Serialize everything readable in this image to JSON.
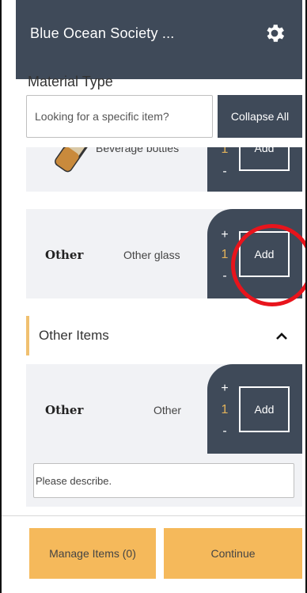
{
  "header": {
    "title": "Blue Ocean Society ...",
    "settings_icon": "gear-icon"
  },
  "section": {
    "title": "Material Type"
  },
  "search": {
    "placeholder": "Looking for a specific item?"
  },
  "collapse_all": {
    "label": "Collapse All"
  },
  "items": [
    {
      "icon": "beverage-bottle-icon",
      "name": "Beverage bottles",
      "plus": "+",
      "quantity": "1",
      "minus": "-",
      "add_label": "Add"
    },
    {
      "material": "Other",
      "name": "Other glass",
      "plus": "+",
      "quantity": "1",
      "minus": "-",
      "add_label": "Add"
    }
  ],
  "other_group": {
    "title": "Other Items",
    "toggle_icon": "chevron-up-icon",
    "item": {
      "material": "Other",
      "name": "Other",
      "plus": "+",
      "quantity": "1",
      "minus": "-",
      "add_label": "Add"
    },
    "describe_placeholder": "Please describe."
  },
  "footer": {
    "manage_label": "Manage Items (0)",
    "continue_label": "Continue"
  },
  "colors": {
    "header": "#3f4a59",
    "accent": "#f5b95b",
    "quantity": "#e3b35a",
    "card_bg": "#f1f2f5",
    "highlight": "#e8141c"
  }
}
